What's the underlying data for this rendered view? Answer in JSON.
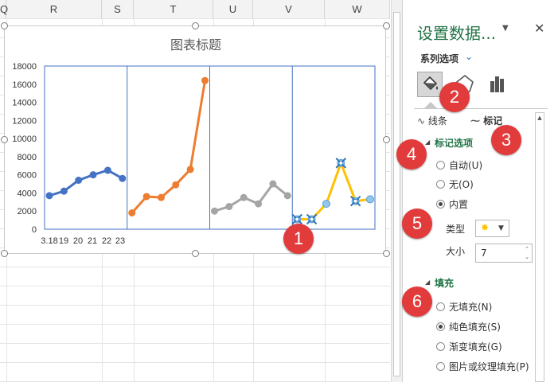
{
  "sheet": {
    "columns": [
      "Q",
      "R",
      "S",
      "T",
      "U",
      "V",
      "W"
    ]
  },
  "chart": {
    "title": "图表标题"
  },
  "chart_data": {
    "type": "line",
    "title": "图表标题",
    "y_ticks": [
      "0",
      "2000",
      "4000",
      "6000",
      "8000",
      "10000",
      "12000",
      "14000",
      "16000",
      "18000"
    ],
    "ylim": [
      0,
      18000
    ],
    "x_tick_labels": [
      "3.18",
      "19",
      "20",
      "21",
      "22",
      "23"
    ],
    "grid": false,
    "panels": 4,
    "series": [
      {
        "values": [
          3700,
          4200,
          5400,
          6000,
          6500,
          5600
        ],
        "color": "#4472c4"
      },
      {
        "values": [
          1800,
          3600,
          3500,
          4900,
          6600,
          16400
        ],
        "color": "#ed7d31"
      },
      {
        "values": [
          2000,
          2500,
          3500,
          2800,
          5000,
          3700
        ],
        "color": "#a5a5a5"
      },
      {
        "values": [
          1100,
          1100,
          2800,
          7300,
          3100,
          3300
        ],
        "color": "#ffc000"
      }
    ]
  },
  "panel": {
    "title": "设置数据...",
    "dropdown_icon": "caret-down-icon",
    "close_icon": "close-icon",
    "series_options": "系列选项",
    "subtab_line": "线条",
    "subtab_marker": "标记",
    "section_marker": "标记选项",
    "marker_auto": "自动(U)",
    "marker_none": "无(O)",
    "marker_builtin": "内置",
    "type_label": "类型",
    "size_label": "大小",
    "size_value": "7",
    "section_fill": "填充",
    "fill_none": "无填充(N)",
    "fill_solid": "纯色填充(S)",
    "fill_gradient": "渐变填充(G)",
    "fill_picture": "图片或纹理填充(P)",
    "accent": "#217346"
  },
  "badges": [
    "1",
    "2",
    "3",
    "4",
    "5",
    "6"
  ]
}
